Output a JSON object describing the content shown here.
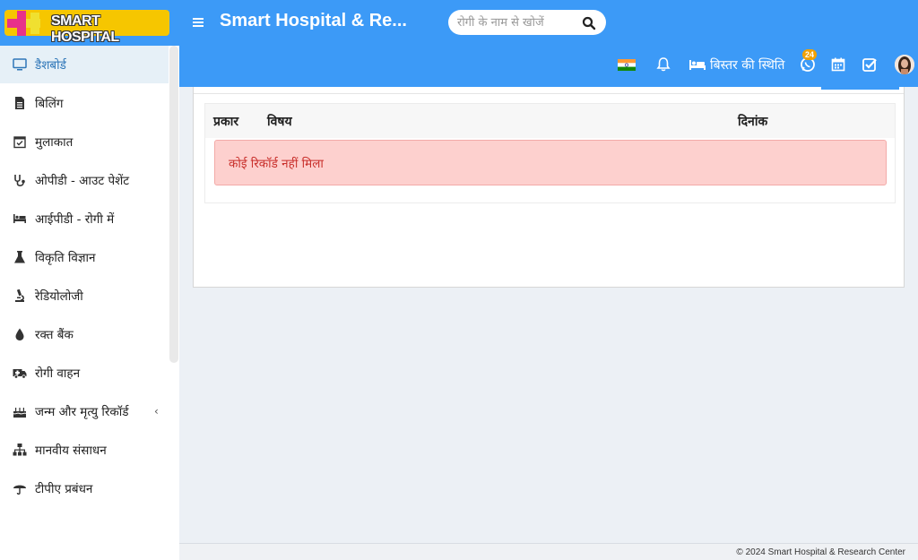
{
  "header": {
    "logo_text": "SMART HOSPITAL",
    "app_title": "Smart Hospital & Re...",
    "search_placeholder": "रोगी के नाम से खोजें",
    "bed_status_label": "बिस्तर की स्थिति",
    "whatsapp_badge": "24",
    "accent_color": "#3c9af7"
  },
  "sidebar": {
    "items": [
      {
        "label": "डैशबोर्ड",
        "icon": "monitor-icon"
      },
      {
        "label": "बिलिंग",
        "icon": "document-icon"
      },
      {
        "label": "मुलाकात",
        "icon": "calendar-check-icon"
      },
      {
        "label": "ओपीडी - आउट पेशेंट",
        "icon": "stethoscope-icon"
      },
      {
        "label": "आईपीडी - रोगी में",
        "icon": "bed-icon"
      },
      {
        "label": "विकृति विज्ञान",
        "icon": "flask-icon"
      },
      {
        "label": "रेडियोलोजी",
        "icon": "microscope-icon"
      },
      {
        "label": "रक्त बैंक",
        "icon": "drop-icon"
      },
      {
        "label": "रोगी वाहन",
        "icon": "ambulance-icon"
      },
      {
        "label": "जन्म और मृत्यु रिकॉर्ड",
        "icon": "birthday-cake-icon"
      },
      {
        "label": "मानवीय संसाधन",
        "icon": "sitemap-icon"
      },
      {
        "label": "टीपीए प्रबंधन",
        "icon": "umbrella-icon"
      }
    ]
  },
  "table": {
    "headers": [
      "प्रकार",
      "विषय",
      "दिनांक"
    ],
    "empty_message": "कोई रिकॉर्ड नहीं मिला"
  },
  "footer": {
    "copyright": "© 2024 Smart Hospital & Research Center"
  }
}
